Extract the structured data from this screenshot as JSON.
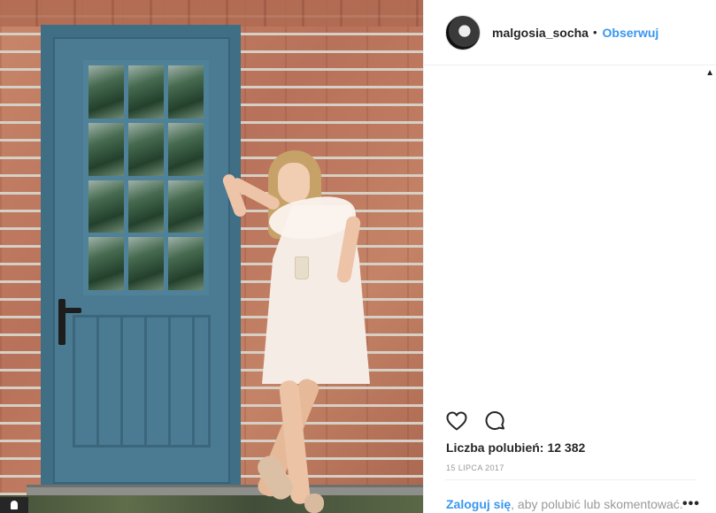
{
  "post": {
    "image_alt": "",
    "author": {
      "username": "malgosia_socha",
      "separator": "•",
      "follow_label": "Obserwuj"
    },
    "actions": {
      "like_icon": "heart-icon",
      "comment_icon": "comment-bubble-icon"
    },
    "likes": {
      "label": "Liczba polubień:",
      "count": "12 382"
    },
    "date": "15 LIPCA 2017",
    "footer": {
      "login_link": "Zaloguj się",
      "login_text": ", aby polubić lub skomentować.",
      "more_label": "•••"
    },
    "scroll_up_glyph": "▲"
  },
  "colors": {
    "link_blue": "#3897f0",
    "text_dark": "#262626",
    "text_muted": "#999999",
    "border": "#efefef"
  }
}
